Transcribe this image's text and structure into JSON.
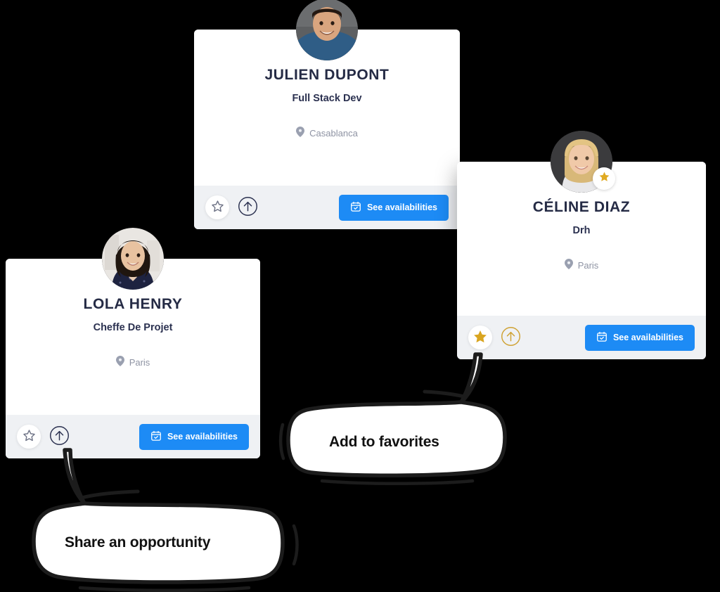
{
  "background_color": "#000000",
  "accent_colors": {
    "button_blue": "#1d8bf5",
    "favorite_gold": "#d9a520",
    "name_navy": "#252b45",
    "location_gray": "#8e93a3",
    "footer_gray": "#eff1f4"
  },
  "cards": [
    {
      "id": "julien",
      "name": "JULIEN DUPONT",
      "role": "Full Stack Dev",
      "location": "Casablanca",
      "location_icon": "map-pin-icon",
      "favorited": false,
      "star_icon": "star-outline-icon",
      "share_icon": "arrow-up-circle-icon",
      "availabilities_label": "See availabilities",
      "availabilities_icon": "calendar-check-icon"
    },
    {
      "id": "celine",
      "name": "CÉLINE DIAZ",
      "role": "Drh",
      "location": "Paris",
      "location_icon": "map-pin-icon",
      "favorited": true,
      "star_icon": "star-filled-icon",
      "share_icon": "arrow-up-circle-icon",
      "badge_icon": "star-filled-icon",
      "availabilities_label": "See availabilities",
      "availabilities_icon": "calendar-check-icon"
    },
    {
      "id": "lola",
      "name": "LOLA HENRY",
      "role": "Cheffe De Projet",
      "location": "Paris",
      "location_icon": "map-pin-icon",
      "favorited": false,
      "star_icon": "star-outline-icon",
      "share_icon": "arrow-up-circle-icon",
      "availabilities_label": "See availabilities",
      "availabilities_icon": "calendar-check-icon"
    }
  ],
  "tooltips": {
    "favorites": {
      "text": "Add to favorites",
      "points_to": "star-button-celine"
    },
    "share": {
      "text": "Share an opportunity",
      "points_to": "share-button-lola"
    }
  }
}
